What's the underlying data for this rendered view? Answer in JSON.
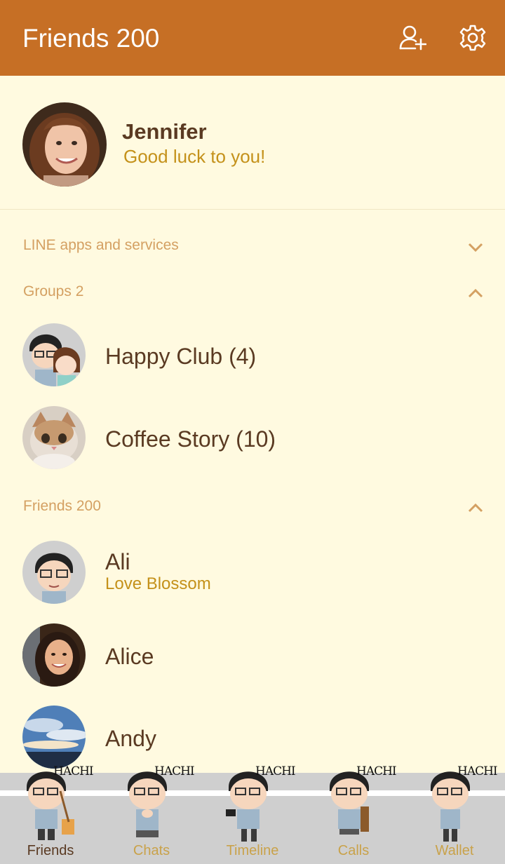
{
  "header": {
    "title": "Friends 200",
    "add_friend_icon": "add-friend-icon",
    "settings_icon": "gear-icon"
  },
  "profile": {
    "name": "Jennifer",
    "status": "Good luck to you!"
  },
  "sections": {
    "line_apps": "LINE apps and services",
    "groups": "Groups 2",
    "friends": "Friends 200"
  },
  "groups": [
    {
      "name": "Happy Club (4)"
    },
    {
      "name": "Coffee Story (10)"
    }
  ],
  "friends": [
    {
      "name": "Ali",
      "status": "Love Blossom"
    },
    {
      "name": "Alice"
    },
    {
      "name": "Andy"
    }
  ],
  "tabs": [
    {
      "label": "Friends",
      "sticker": "HACHI",
      "active": true
    },
    {
      "label": "Chats",
      "sticker": "HACHI"
    },
    {
      "label": "Timeline",
      "sticker": "HACHI"
    },
    {
      "label": "Calls",
      "sticker": "HACHI"
    },
    {
      "label": "Wallet",
      "sticker": "HACHI"
    }
  ],
  "colors": {
    "header_bg": "#c66f25",
    "page_bg": "#fffae0",
    "accent_text": "#c4911a",
    "section_text": "#d4a062",
    "name_text": "#5a3a22",
    "tabbar_bg": "#cfcfcf"
  }
}
